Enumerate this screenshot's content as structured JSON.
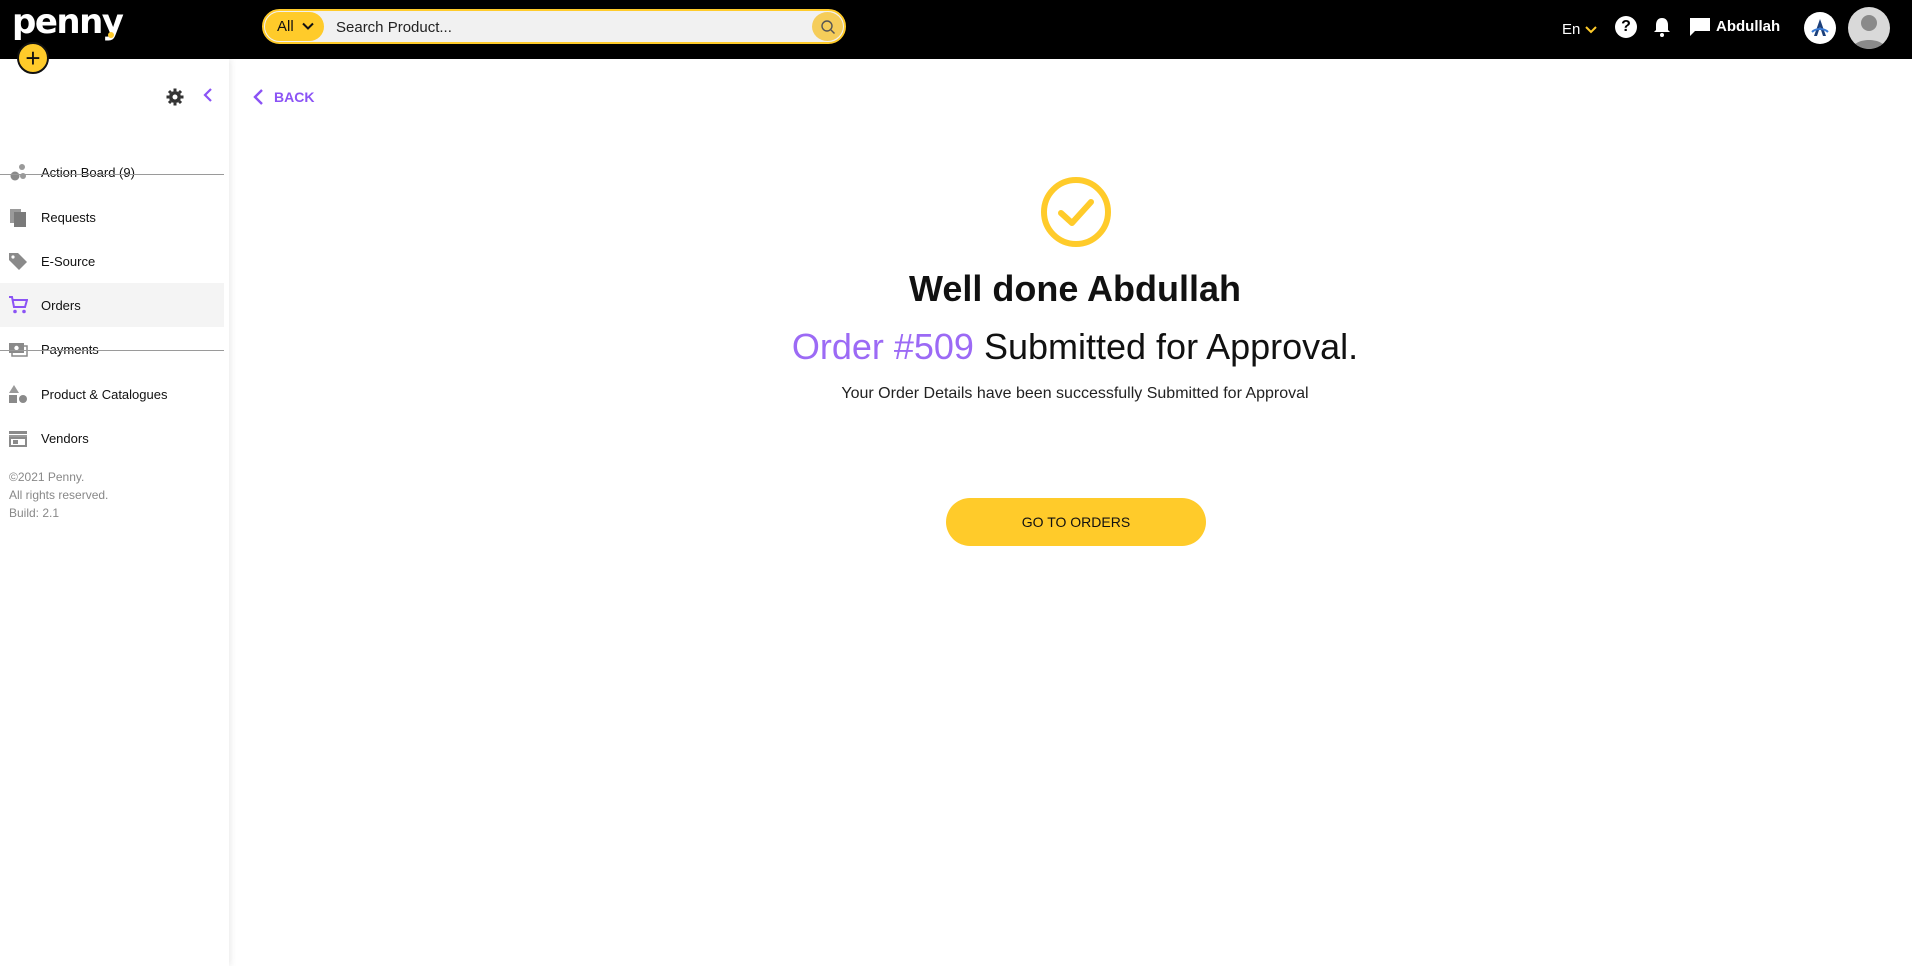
{
  "app": {
    "logo_text": "penny"
  },
  "header": {
    "search": {
      "category": "All",
      "placeholder": "Search Product..."
    },
    "language": "En",
    "user_name": "Abdullah"
  },
  "sidebar": {
    "items": [
      {
        "label": "Action Board (9)",
        "icon": "bubbles-icon",
        "active": false
      },
      {
        "label": "Requests",
        "icon": "documents-icon",
        "active": false
      },
      {
        "label": "E-Source",
        "icon": "tag-icon",
        "active": false
      },
      {
        "label": "Orders",
        "icon": "cart-icon",
        "active": true
      },
      {
        "label": "Payments",
        "icon": "money-icon",
        "active": false
      },
      {
        "label": "Product & Catalogues",
        "icon": "shapes-icon",
        "active": false
      },
      {
        "label": "Vendors",
        "icon": "store-icon",
        "active": false
      }
    ],
    "footer": {
      "copyright": "©2021 Penny.",
      "rights": "All rights reserved.",
      "build": "Build: 2.1"
    }
  },
  "main": {
    "back_label": "BACK",
    "title": "Well done Abdullah",
    "order_label": "Order #509",
    "status_text": "Submitted for Approval.",
    "description": "Your Order Details have been successfully Submitted for Approval",
    "cta_label": "GO TO ORDERS"
  },
  "colors": {
    "accent_yellow": "#ffcb2a",
    "accent_purple": "#8b53f5",
    "header_bg": "#000000"
  }
}
